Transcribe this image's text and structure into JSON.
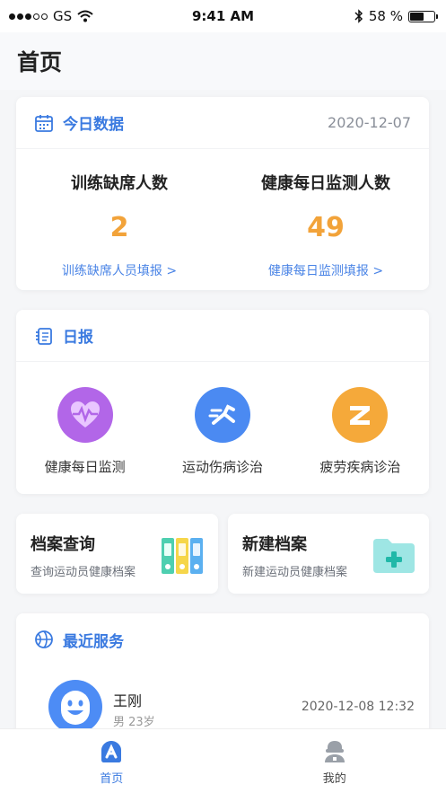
{
  "status_bar": {
    "carrier": "GS",
    "time": "9:41 AM",
    "battery_text": "58 %",
    "battery_level": 0.58
  },
  "header": {
    "title": "首页"
  },
  "today": {
    "title": "今日数据",
    "date": "2020-12-07",
    "stats": [
      {
        "label": "训练缺席人数",
        "value": "2",
        "link": "训练缺席人员填报 >"
      },
      {
        "label": "健康每日监测人数",
        "value": "49",
        "link": "健康每日监测填报 >"
      }
    ]
  },
  "daily": {
    "title": "日报",
    "items": [
      {
        "label": "健康每日监测",
        "icon": "heart-pulse-icon",
        "color": "#b266e8"
      },
      {
        "label": "运动伤病诊治",
        "icon": "runner-icon",
        "color": "#4b8af2"
      },
      {
        "label": "疲劳疾病诊治",
        "icon": "z-letter-icon",
        "color": "#f5a93a"
      }
    ]
  },
  "tiles": [
    {
      "title": "档案查询",
      "subtitle": "查询运动员健康档案",
      "icon": "binders-icon"
    },
    {
      "title": "新建档案",
      "subtitle": "新建运动员健康档案",
      "icon": "add-folder-icon"
    }
  ],
  "recent": {
    "title": "最近服务",
    "items": [
      {
        "name": "王刚",
        "meta": "男 23岁",
        "time": "2020-12-08 12:32"
      }
    ]
  },
  "tabbar": {
    "tabs": [
      {
        "label": "首页",
        "icon": "home-icon",
        "active": true
      },
      {
        "label": "我的",
        "icon": "profile-icon",
        "active": false
      }
    ]
  },
  "colors": {
    "accent": "#3a7ae0",
    "stat_value": "#f2a33a",
    "link": "#4a84e6",
    "background": "#f5f6f8"
  }
}
